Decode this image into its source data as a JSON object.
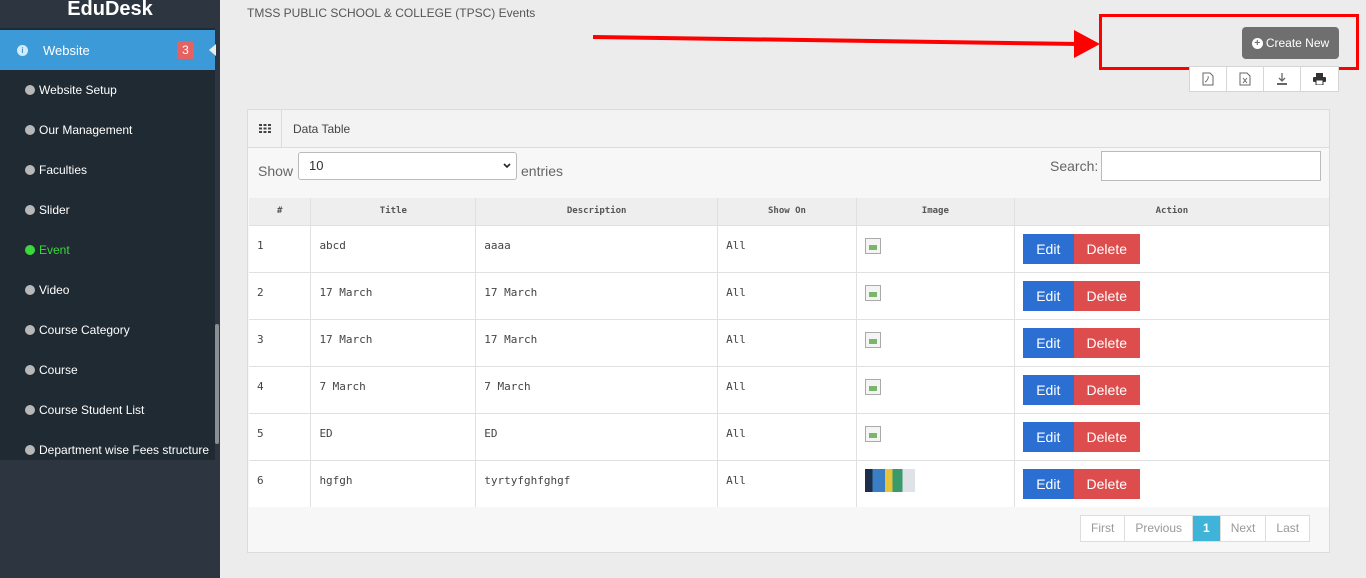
{
  "brand": "EduDesk",
  "sidebar": {
    "active": {
      "label": "Website",
      "badge": "3"
    },
    "items": [
      {
        "label": "Website Setup"
      },
      {
        "label": "Our Management"
      },
      {
        "label": "Faculties"
      },
      {
        "label": "Slider"
      },
      {
        "label": "Event",
        "current": true
      },
      {
        "label": "Video"
      },
      {
        "label": "Course Category"
      },
      {
        "label": "Course"
      },
      {
        "label": "Course Student List"
      },
      {
        "label": "Department wise Fees structure"
      }
    ]
  },
  "page": {
    "title": "TMSS PUBLIC SCHOOL & COLLEGE (TPSC) Events",
    "create_label": "Create New"
  },
  "export_icons": [
    "pdf-icon",
    "excel-icon",
    "download-icon",
    "print-icon"
  ],
  "panel": {
    "title": "Data Table",
    "show_label": "Show",
    "page_length": "10",
    "entries_label": "entries",
    "search_label": "Search:"
  },
  "table": {
    "columns": [
      "#",
      "Title",
      "Description",
      "Show On",
      "Image",
      "Action"
    ],
    "rows": [
      {
        "num": "1",
        "title": "abcd",
        "description": "aaaa",
        "show_on": "All",
        "image": "broken"
      },
      {
        "num": "2",
        "title": "17 March",
        "description": "17 March",
        "show_on": "All",
        "image": "broken"
      },
      {
        "num": "3",
        "title": "17 March",
        "description": "17 March",
        "show_on": "All",
        "image": "broken"
      },
      {
        "num": "4",
        "title": "7 March",
        "description": "7 March",
        "show_on": "All",
        "image": "broken"
      },
      {
        "num": "5",
        "title": "ED",
        "description": "ED",
        "show_on": "All",
        "image": "broken"
      },
      {
        "num": "6",
        "title": "hgfgh",
        "description": "tyrtyfghfghgf",
        "show_on": "All",
        "image": "thumbnail"
      }
    ],
    "edit_label": "Edit",
    "delete_label": "Delete"
  },
  "pagination": {
    "first": "First",
    "previous": "Previous",
    "current": "1",
    "next": "Next",
    "last": "Last"
  },
  "colors": {
    "sidebar_bg": "#1f2a32",
    "active_nav": "#3c9ad9",
    "current_item": "#3ad83a",
    "edit_button": "#2a6fd1",
    "delete_button": "#de4d4d",
    "annotation": "#ff0000",
    "page_active": "#3fb4d8"
  }
}
